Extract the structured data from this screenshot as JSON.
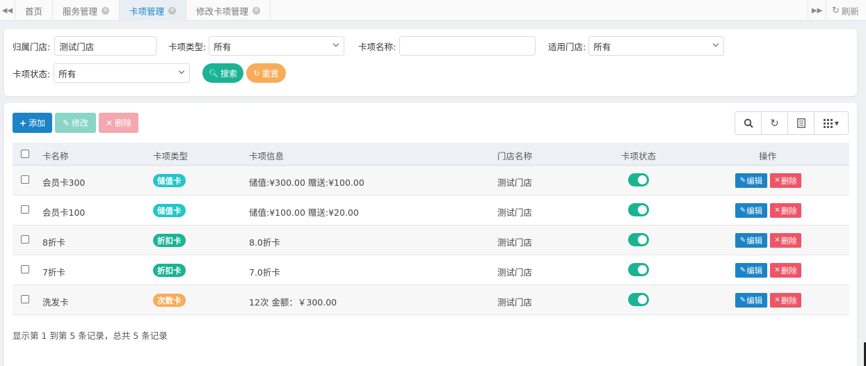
{
  "tabbar": {
    "tabs": [
      {
        "label": "首页",
        "closable": false,
        "active": false
      },
      {
        "label": "服务管理",
        "closable": true,
        "active": false
      },
      {
        "label": "卡项管理",
        "closable": true,
        "active": true
      },
      {
        "label": "修改卡项管理",
        "closable": true,
        "active": false
      }
    ],
    "refresh_label": "刷新"
  },
  "search": {
    "store_label": "归属门店:",
    "store_value": "测试门店",
    "card_type_label": "卡项类型:",
    "card_type_value": "所有",
    "card_name_label": "卡项名称:",
    "card_name_value": "",
    "applicable_store_label": "适用门店:",
    "applicable_store_value": "所有",
    "card_status_label": "卡项状态:",
    "card_status_value": "所有",
    "search_button": "搜索",
    "reset_button": "重置"
  },
  "toolbar": {
    "add_label": "添加",
    "edit_label": "修改",
    "delete_label": "删除"
  },
  "table": {
    "headers": {
      "name": "卡名称",
      "type": "卡项类型",
      "info": "卡项信息",
      "store": "门店名称",
      "status": "卡项状态",
      "actions": "操作"
    },
    "rows": [
      {
        "name": "会员卡300",
        "type": "储值卡",
        "type_color": "#23c6c8",
        "info": "储值:¥300.00 赠送:¥100.00",
        "store": "测试门店",
        "enabled": true
      },
      {
        "name": "会员卡100",
        "type": "储值卡",
        "type_color": "#23c6c8",
        "info": "储值:¥100.00 赠送:¥20.00",
        "store": "测试门店",
        "enabled": true
      },
      {
        "name": "8折卡",
        "type": "折扣卡",
        "type_color": "#1ab394",
        "info": "8.0折卡",
        "store": "测试门店",
        "enabled": true
      },
      {
        "name": "7折卡",
        "type": "折扣卡",
        "type_color": "#1ab394",
        "info": "7.0折卡",
        "store": "测试门店",
        "enabled": true
      },
      {
        "name": "洗发卡",
        "type": "次数卡",
        "type_color": "#f8ac59",
        "info": "12次 金额：￥300.00",
        "store": "测试门店",
        "enabled": true
      }
    ],
    "edit_label": "编辑",
    "delete_label": "删除",
    "footer": "显示第 1 到第 5 条记录，总共 5 条记录"
  },
  "colors": {
    "primary": "#1c84c6",
    "success": "#1ab394",
    "warning": "#f8ac59",
    "danger": "#ed5565",
    "info": "#23c6c8"
  }
}
